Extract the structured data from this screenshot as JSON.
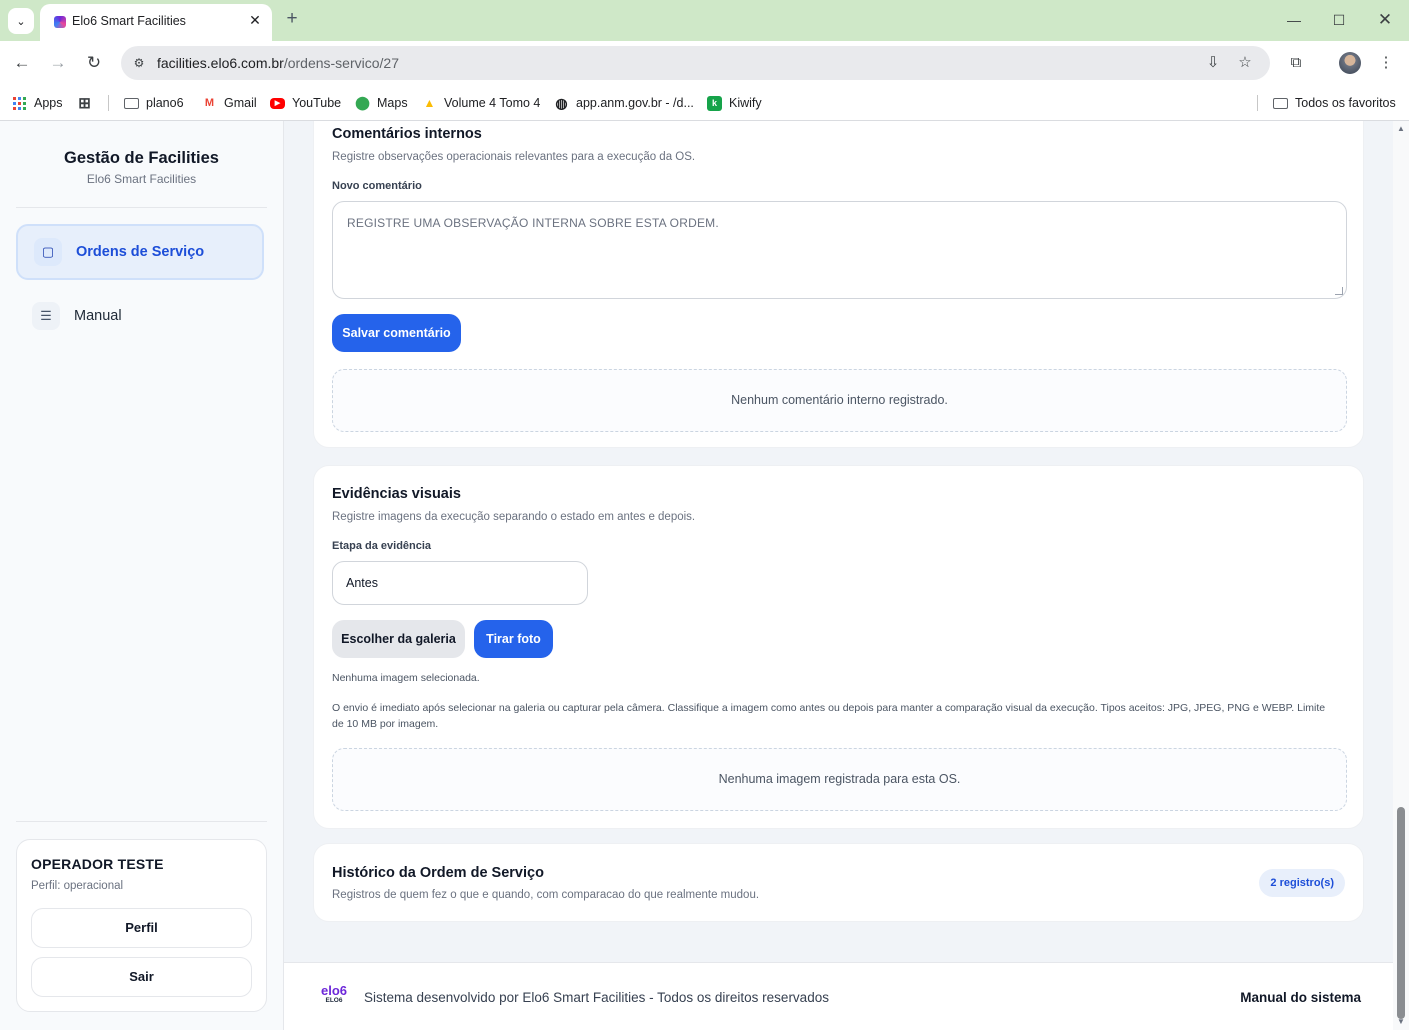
{
  "browser": {
    "tab_title": "Elo6 Smart Facilities",
    "url_domain": "facilities.elo6.com.br",
    "url_path": "/ordens-servico/27",
    "bookmarks": [
      {
        "label": "Apps",
        "icon": "apps-grid-icon"
      },
      {
        "label": "plano6",
        "icon": "folder-icon"
      },
      {
        "label": "Gmail",
        "icon": "gmail-icon"
      },
      {
        "label": "YouTube",
        "icon": "youtube-icon"
      },
      {
        "label": "Maps",
        "icon": "maps-icon"
      },
      {
        "label": "Volume 4 Tomo 4",
        "icon": "drive-icon"
      },
      {
        "label": "app.anm.gov.br - /d...",
        "icon": "globe-icon"
      },
      {
        "label": "Kiwify",
        "icon": "kiwify-icon"
      }
    ],
    "all_bookmarks": "Todos os favoritos"
  },
  "sidebar": {
    "title": "Gestão de Facilities",
    "subtitle": "Elo6 Smart Facilities",
    "nav": [
      {
        "label": "Ordens de Serviço",
        "icon": "clipboard-icon",
        "active": true
      },
      {
        "label": "Manual",
        "icon": "document-icon",
        "active": false
      }
    ],
    "user": {
      "name": "OPERADOR TESTE",
      "role": "Perfil: operacional",
      "profile_button": "Perfil",
      "logout_button": "Sair"
    }
  },
  "comments": {
    "title": "Comentários internos",
    "subtitle": "Registre observações operacionais relevantes para a execução da OS.",
    "field_label": "Novo comentário",
    "placeholder": "REGISTRE UMA OBSERVAÇÃO INTERNA SOBRE ESTA ORDEM.",
    "save_button": "Salvar comentário",
    "empty": "Nenhum comentário interno registrado."
  },
  "evidence": {
    "title": "Evidências visuais",
    "subtitle": "Registre imagens da execução separando o estado em antes e depois.",
    "stage_label": "Etapa da evidência",
    "stage_value": "Antes",
    "gallery_button": "Escolher da galeria",
    "photo_button": "Tirar foto",
    "no_selection": "Nenhuma imagem selecionada.",
    "help_text": "O envio é imediato após selecionar na galeria ou capturar pela câmera. Classifique a imagem como antes ou depois para manter a comparação visual da execução. Tipos aceitos: JPG, JPEG, PNG e WEBP. Limite de 10 MB por imagem.",
    "empty": "Nenhuma imagem registrada para esta OS."
  },
  "history": {
    "title": "Histórico da Ordem de Serviço",
    "subtitle": "Registros de quem fez o que e quando, com comparacao do que realmente mudou.",
    "badge": "2 registro(s)"
  },
  "footer": {
    "logo_text": "elo6",
    "logo_sub": "ELO6",
    "text": "Sistema desenvolvido por Elo6 Smart Facilities - Todos os direitos reservados",
    "manual_link": "Manual do sistema"
  },
  "colors": {
    "primary": "#2563eb",
    "active_nav_bg": "#e7effb",
    "chrome_tabbar": "#cfe8c8"
  }
}
